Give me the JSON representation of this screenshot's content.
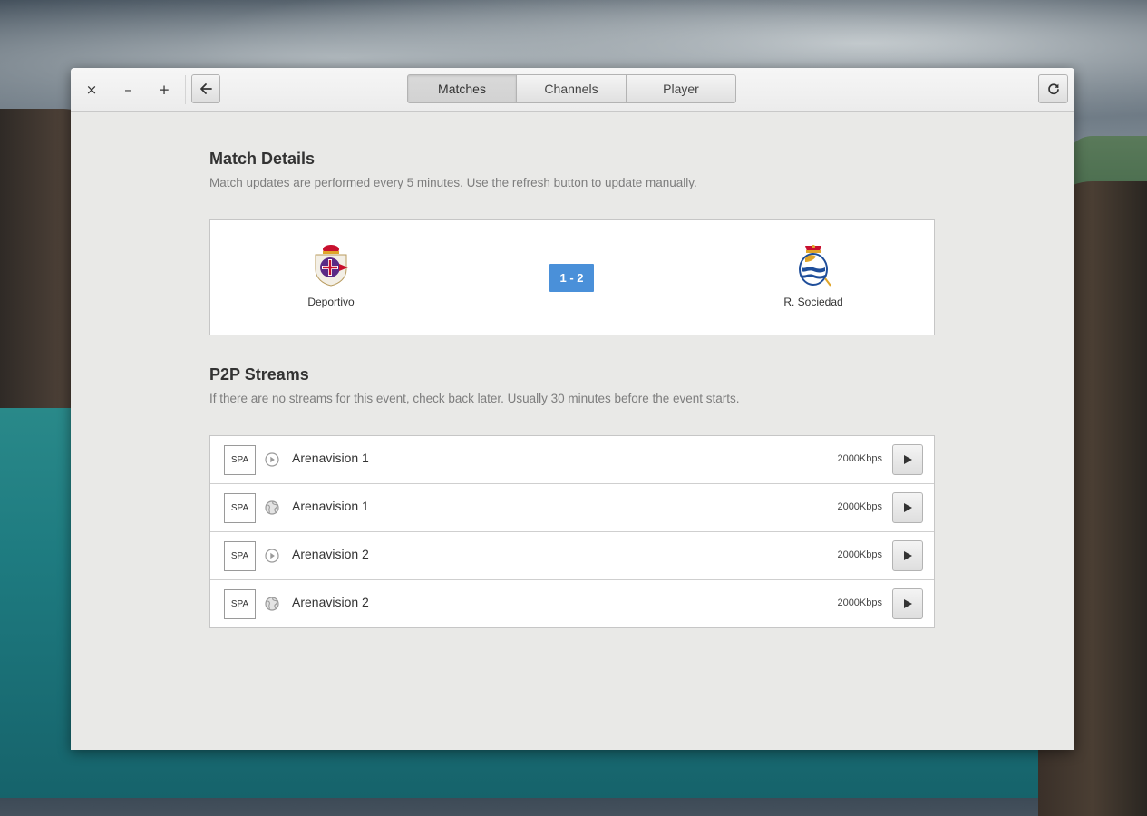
{
  "window": {
    "controls": {
      "close": "×",
      "minimize": "–",
      "maximize": "+"
    }
  },
  "header": {
    "tabs": [
      {
        "label": "Matches",
        "active": true
      },
      {
        "label": "Channels",
        "active": false
      },
      {
        "label": "Player",
        "active": false
      }
    ],
    "back_icon": "arrow-left-icon",
    "refresh_icon": "refresh-icon"
  },
  "match_details": {
    "title": "Match Details",
    "subtitle": "Match updates are performed every 5 minutes. Use the refresh button to update manually.",
    "home_team": {
      "name": "Deportivo",
      "crest_icon": "deportivo-crest-icon",
      "colors": [
        "#5b2a86",
        "#ffffff",
        "#c8102e"
      ]
    },
    "away_team": {
      "name": "R. Sociedad",
      "crest_icon": "real-sociedad-crest-icon",
      "colors": [
        "#1f4e9a",
        "#ffffff",
        "#e0a52a"
      ]
    },
    "score": "1 - 2",
    "score_color": "#4a90d9"
  },
  "streams": {
    "title": "P2P Streams",
    "subtitle": "If there are no streams for this event, check back later. Usually 30 minutes before the event starts.",
    "items": [
      {
        "lang": "SPA",
        "type_icon": "play-circle-icon",
        "name": "Arenavision 1",
        "bitrate": "2000Kbps"
      },
      {
        "lang": "SPA",
        "type_icon": "globe-icon",
        "name": "Arenavision 1",
        "bitrate": "2000Kbps"
      },
      {
        "lang": "SPA",
        "type_icon": "play-circle-icon",
        "name": "Arenavision 2",
        "bitrate": "2000Kbps"
      },
      {
        "lang": "SPA",
        "type_icon": "globe-icon",
        "name": "Arenavision 2",
        "bitrate": "2000Kbps"
      }
    ]
  }
}
